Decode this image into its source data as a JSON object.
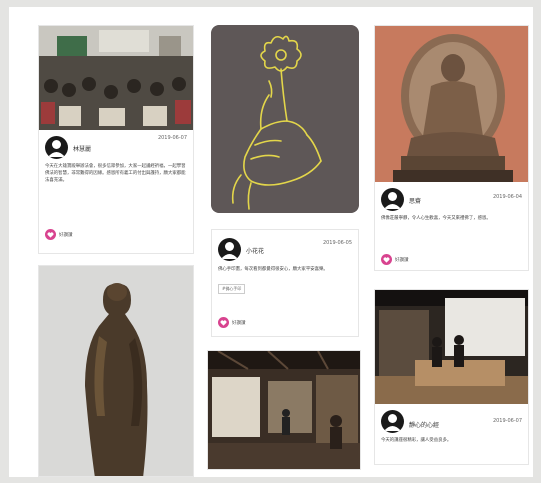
{
  "cards": [
    {
      "user": "林慧麗",
      "date": "2019-06-07",
      "text": "今天在大雄寶殿舉辦法會，很多信眾參加，大家一起誦經祈福，一起學習佛法的智慧，非常難得的因緣。感恩所有義工的付出與護持，願大家都能法喜充滿。",
      "like": "好讚讚"
    },
    {
      "user": "小花花",
      "date": "2019-06-05",
      "text": "佛心手印畫，每次看到都覺得很安心，願大家平安喜樂。",
      "tag": "#佛心手印",
      "like": "好讚讚"
    },
    {
      "user": "思齋",
      "date": "2019-06-04",
      "text": "佛像莊嚴寧靜，令人心生歡喜，今天又來禮佛了，感恩。",
      "like": "好讚讚"
    },
    {
      "user": "靜心的心經",
      "date": "2019-06-07",
      "text": "今天的講座很精彩，讓人受益良多。"
    }
  ],
  "colors": {
    "accent": "#d8438f",
    "hand_bg": "#5e5757",
    "hand_line": "#e3d64a",
    "buddha_bg": "#c77a5e"
  },
  "icons": {
    "avatar": "user-avatar-icon",
    "like": "heart-icon"
  }
}
